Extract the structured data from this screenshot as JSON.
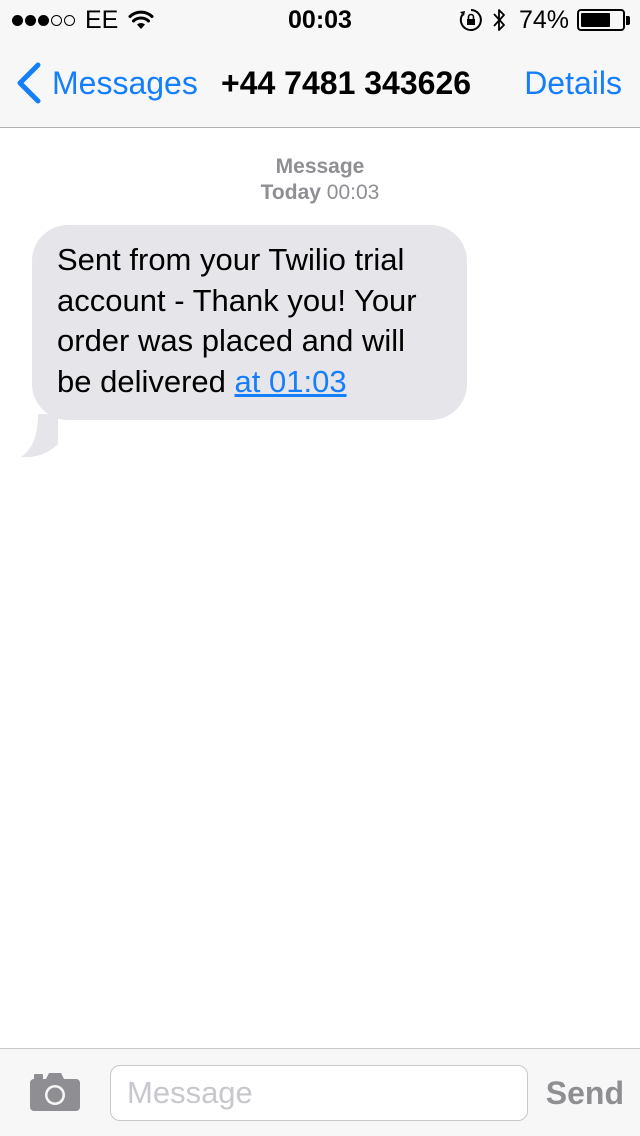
{
  "status_bar": {
    "signal_bars_filled": 3,
    "signal_bars_total": 5,
    "carrier": "EE",
    "time": "00:03",
    "battery_percent": "74%",
    "battery_level": 0.74,
    "icons": [
      "wifi-icon",
      "orientation-lock-icon",
      "bluetooth-icon",
      "battery-icon"
    ]
  },
  "nav": {
    "back_label": "Messages",
    "title": "+44 7481 343626",
    "details_label": "Details"
  },
  "conversation": {
    "timestamp_line1": "Message",
    "timestamp_day": "Today",
    "timestamp_time": "00:03",
    "message_text": "Sent from your Twilio trial account - Thank you! Your order was placed and will be delivered ",
    "message_link": "at 01:03"
  },
  "input_bar": {
    "placeholder": "Message",
    "send_label": "Send",
    "camera_icon": "camera-icon"
  },
  "colors": {
    "accent": "#157efb",
    "bubble_gray": "#e5e5ea",
    "bar_background": "#f7f7f7",
    "secondary_text": "#8e8e93"
  }
}
